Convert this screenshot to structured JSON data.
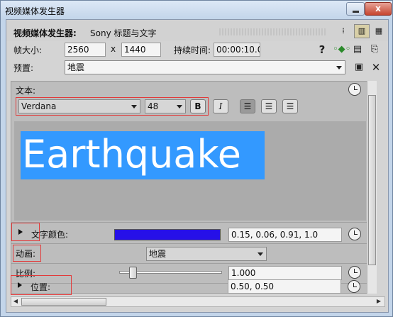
{
  "window": {
    "title": "视频媒体发生器",
    "minimize_label": "",
    "close_label": "x"
  },
  "header": {
    "label": "视频媒体发生器:",
    "value": "Sony 标题与文字"
  },
  "frame": {
    "label": "帧大小:",
    "width": "2560",
    "x_sep": "x",
    "height": "1440",
    "duration_label": "持续时间:",
    "duration": "00:00:10.00"
  },
  "preset": {
    "label": "预置:",
    "value": "地震"
  },
  "text_section": {
    "label": "文本:"
  },
  "font": {
    "family": "Verdana",
    "size": "48",
    "bold": "B",
    "italic": "I"
  },
  "content": {
    "text": "Earthquake"
  },
  "text_color": {
    "label": "文字颜色:",
    "value": "0.15, 0.06, 0.91, 1.0",
    "color": "#2610e8"
  },
  "animation": {
    "label": "动画:",
    "value": "地震"
  },
  "scale": {
    "label": "比例:",
    "value": "1.000",
    "level": 0.1
  },
  "position": {
    "label": "位置:",
    "value": "0.50, 0.50"
  },
  "icons": [
    "help-icon",
    "keyframe-icon",
    "save-icon",
    "grid-icon",
    "clock-icon",
    "align-left-icon",
    "align-center-icon",
    "align-right-icon"
  ]
}
